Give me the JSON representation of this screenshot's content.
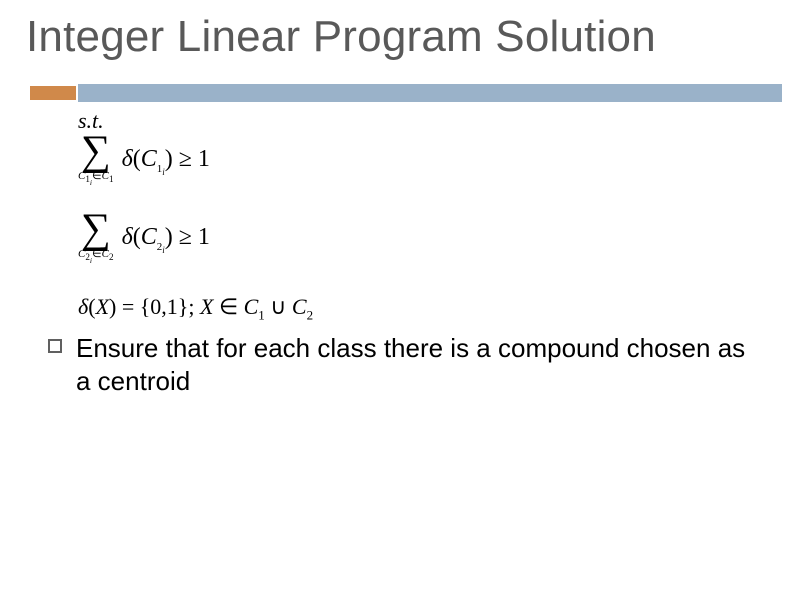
{
  "title": "Integer Linear Program Solution",
  "math": {
    "st": "s.t.",
    "eq1": {
      "sum_sub": "C₁ᵢ ∈ C₁",
      "expr": "δ(C₁ᵢ) ≥ 1"
    },
    "eq2": {
      "sum_sub": "C₂ᵢ ∈ C₂",
      "expr": "δ(C₂ᵢ) ≥ 1"
    },
    "eq3": "δ(X) = {0,1}; X ∈ C₁ ∪ C₂"
  },
  "bullet": "Ensure that for each class there is a compound chosen as a centroid"
}
